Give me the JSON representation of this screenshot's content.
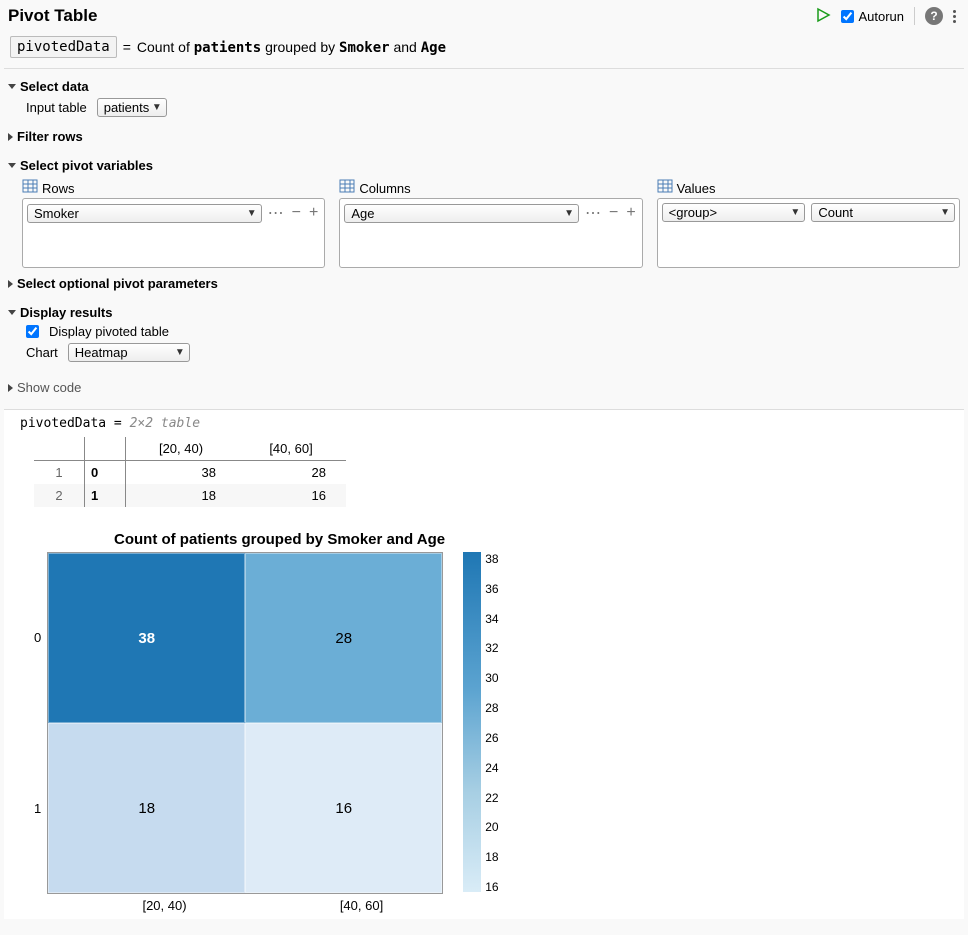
{
  "header": {
    "title": "Pivot Table",
    "autorun_label": "Autorun",
    "autorun_checked": true
  },
  "expression": {
    "output_var": "pivotedData",
    "equals": "=",
    "desc_prefix": "Count of",
    "desc_table": "patients",
    "desc_mid": "grouped by",
    "desc_row": "Smoker",
    "desc_and": "and",
    "desc_col": "Age"
  },
  "sections": {
    "select_data": {
      "title": "Select data",
      "expanded": true,
      "input_label": "Input table",
      "input_table": "patients"
    },
    "filter_rows": {
      "title": "Filter rows",
      "expanded": false
    },
    "select_pivot": {
      "title": "Select pivot variables",
      "expanded": true,
      "rows": {
        "heading": "Rows",
        "value": "Smoker"
      },
      "columns": {
        "heading": "Columns",
        "value": "Age"
      },
      "values": {
        "heading": "Values",
        "group": "<group>",
        "aggregation": "Count"
      }
    },
    "optional": {
      "title": "Select optional pivot parameters",
      "expanded": false
    },
    "display": {
      "title": "Display results",
      "expanded": true,
      "cb_label": "Display pivoted table",
      "cb_checked": true,
      "chart_label": "Chart",
      "chart_value": "Heatmap"
    },
    "show_code": {
      "title": "Show code",
      "expanded": false
    }
  },
  "results": {
    "var_name": "pivotedData",
    "eq": "=",
    "summary": "2×2 table",
    "columns": [
      "[20, 40)",
      "[40, 60]"
    ],
    "rows": [
      {
        "idx": "1",
        "label": "0",
        "cells": [
          "38",
          "28"
        ]
      },
      {
        "idx": "2",
        "label": "1",
        "cells": [
          "18",
          "16"
        ]
      }
    ]
  },
  "chart_data": {
    "type": "heatmap",
    "title": "Count of patients grouped by Smoker and Age",
    "x_categories": [
      "[20, 40)",
      "[40, 60]"
    ],
    "y_categories": [
      "0",
      "1"
    ],
    "values": [
      [
        38,
        28
      ],
      [
        18,
        16
      ]
    ],
    "colorbar": {
      "min": 16,
      "max": 38,
      "ticks": [
        "38",
        "36",
        "34",
        "32",
        "30",
        "28",
        "26",
        "24",
        "22",
        "20",
        "18",
        "16"
      ]
    },
    "cell_colors": [
      [
        "#1f77b4",
        "#6baed6"
      ],
      [
        "#c6dbef",
        "#deebf7"
      ]
    ],
    "cell_textcolors": [
      [
        "#fff",
        "#000"
      ],
      [
        "#000",
        "#000"
      ]
    ]
  }
}
